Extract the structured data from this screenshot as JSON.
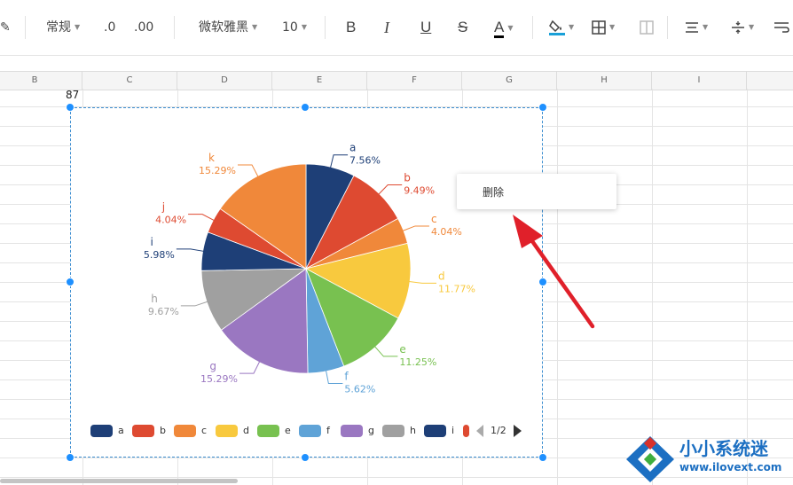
{
  "toolbar": {
    "number_format": "常规",
    "decrease_decimal": ".0",
    "increase_decimal": ".00",
    "font_name": "微软雅黑",
    "font_size": "10",
    "bold_label": "B",
    "italic_label": "I",
    "underline_label": "U",
    "strike_label": "S",
    "font_color_label": "A"
  },
  "columns": [
    "B",
    "C",
    "D",
    "E",
    "F",
    "G",
    "H",
    "I"
  ],
  "cell_value": "87",
  "context_menu": {
    "delete_label": "删除"
  },
  "chart_data": {
    "type": "pie",
    "slices": [
      {
        "label": "a",
        "value": 7.56,
        "pct": "7.56%",
        "color": "#1e3f77"
      },
      {
        "label": "b",
        "value": 9.49,
        "pct": "9.49%",
        "color": "#de4a31"
      },
      {
        "label": "c",
        "value": 4.04,
        "pct": "4.04%",
        "color": "#f0883a"
      },
      {
        "label": "d",
        "value": 11.77,
        "pct": "11.77%",
        "color": "#f8c93e"
      },
      {
        "label": "e",
        "value": 11.25,
        "pct": "11.25%",
        "color": "#78c150"
      },
      {
        "label": "f",
        "value": 5.62,
        "pct": "5.62%",
        "color": "#5fa3d7"
      },
      {
        "label": "g",
        "value": 15.29,
        "pct": "15.29%",
        "color": "#9a77c1"
      },
      {
        "label": "h",
        "value": 9.67,
        "pct": "9.67%",
        "color": "#a0a0a0"
      },
      {
        "label": "i",
        "value": 5.98,
        "pct": "5.98%",
        "color": "#1e3f77"
      },
      {
        "label": "j",
        "value": 4.04,
        "pct": "4.04%",
        "color": "#de4a31"
      },
      {
        "label": "k",
        "value": 15.29,
        "pct": "15.29%",
        "color": "#f0883a"
      }
    ],
    "legend": [
      "a",
      "b",
      "c",
      "d",
      "e",
      "f",
      "g",
      "h",
      "i"
    ],
    "legend_page": "1/2"
  },
  "watermark": {
    "title": "小小系统迷",
    "url": "www.ilovext.com"
  }
}
